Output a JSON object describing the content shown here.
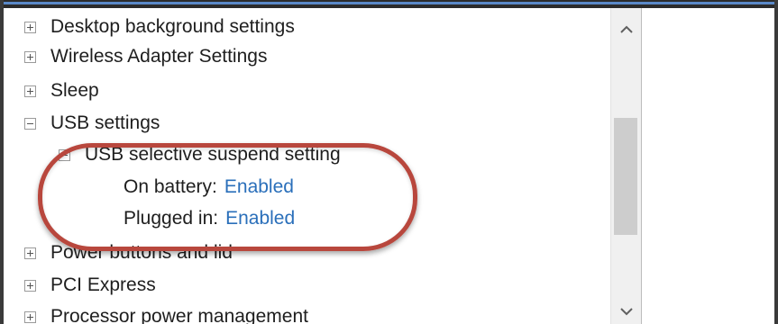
{
  "tree": {
    "items": [
      {
        "label": "Desktop background settings",
        "state": "collapsed"
      },
      {
        "label": "Wireless Adapter Settings",
        "state": "collapsed"
      },
      {
        "label": "Sleep",
        "state": "collapsed"
      },
      {
        "label": "USB settings",
        "state": "expanded"
      },
      {
        "label": "USB selective suspend setting",
        "state": "expanded"
      },
      {
        "label": "On battery:",
        "value": "Enabled"
      },
      {
        "label": "Plugged in:",
        "value": "Enabled"
      },
      {
        "label": "Power buttons and lid",
        "state": "collapsed"
      },
      {
        "label": "PCI Express",
        "state": "collapsed"
      },
      {
        "label": "Processor power management",
        "state": "collapsed"
      }
    ]
  },
  "icons": {
    "expand": "plus-box-icon",
    "collapse": "minus-box-icon",
    "scroll_up": "chevron-up-icon",
    "scroll_down": "chevron-down-icon"
  },
  "colors": {
    "link": "#2a6fba",
    "highlight": "#b8473d",
    "window_accent": "#5a88c7"
  }
}
